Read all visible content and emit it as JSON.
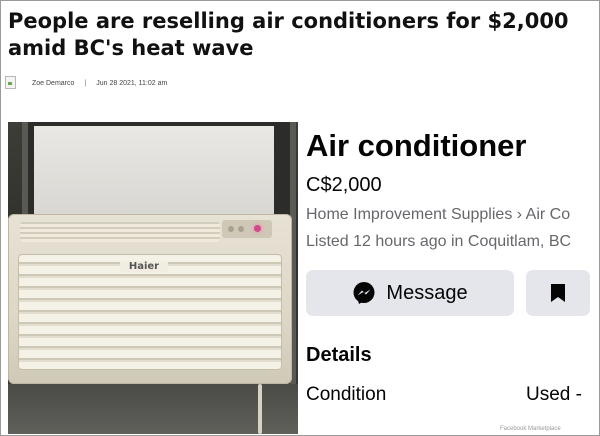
{
  "article": {
    "headline": "People are reselling air conditioners for $2,000 amid BC's heat wave",
    "author": "Zoe Demarco",
    "separator": "|",
    "date": "Jun 28 2021, 11:02 am"
  },
  "listing": {
    "photo_brand": "Haier",
    "title": "Air conditioner",
    "price": "C$2,000",
    "category_path": "Home Improvement Supplies › Air Co",
    "listed": "Listed 12 hours ago in Coquitlam, BC",
    "message_button": "Message",
    "details_heading": "Details",
    "condition_label": "Condition",
    "condition_value": "Used -",
    "watermark": "Facebook Marketplace"
  },
  "icons": {
    "messenger": "messenger-icon",
    "save": "bookmark-icon",
    "author_avatar": "broken-image-icon"
  },
  "colors": {
    "button_bg": "#e4e6eb",
    "secondary_text": "#65676b",
    "led": "#d14a8a"
  }
}
